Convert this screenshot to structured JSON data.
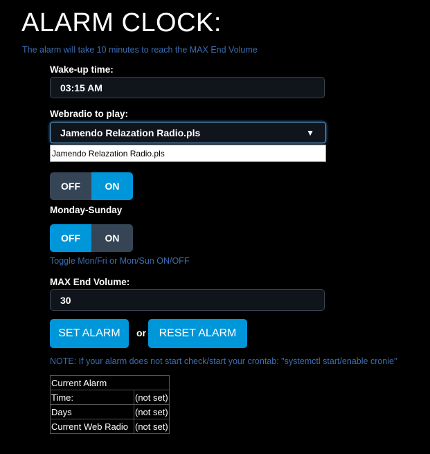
{
  "title": "ALARM CLOCK:",
  "subtitle": "The alarm will take 10 minutes to reach the MAX End Volume",
  "wakeup": {
    "label": "Wake-up time:",
    "value": "03:15 AM"
  },
  "webradio": {
    "label": "Webradio to play:",
    "value": "Jamendo Relazation Radio.pls",
    "options": [
      "Jamendo Relazation Radio.pls"
    ]
  },
  "toggle1": {
    "off": "OFF",
    "on": "ON",
    "state": "ON"
  },
  "toggle2": {
    "label": "Monday-Sunday",
    "off": "OFF",
    "on": "ON",
    "state": "OFF"
  },
  "toggle_hint": "Toggle Mon/Fri or Mon/Sun ON/OFF",
  "volume": {
    "label": "MAX End Volume:",
    "value": "30"
  },
  "buttons": {
    "set": "SET ALARM",
    "or": "or",
    "reset": "RESET ALARM"
  },
  "note": "NOTE: If your alarm does not start check/start your crontab: \"systemctl start/enable cronie\"",
  "current": {
    "header": "Current Alarm",
    "rows": [
      {
        "label": "Time:",
        "value": "(not set)"
      },
      {
        "label": "Days",
        "value": "(not set)"
      },
      {
        "label": "Current Web Radio",
        "value": "(not set)"
      }
    ]
  },
  "colors": {
    "accent": "#0096da",
    "toggle_off": "#364556",
    "info_text": "#3b6db0"
  }
}
